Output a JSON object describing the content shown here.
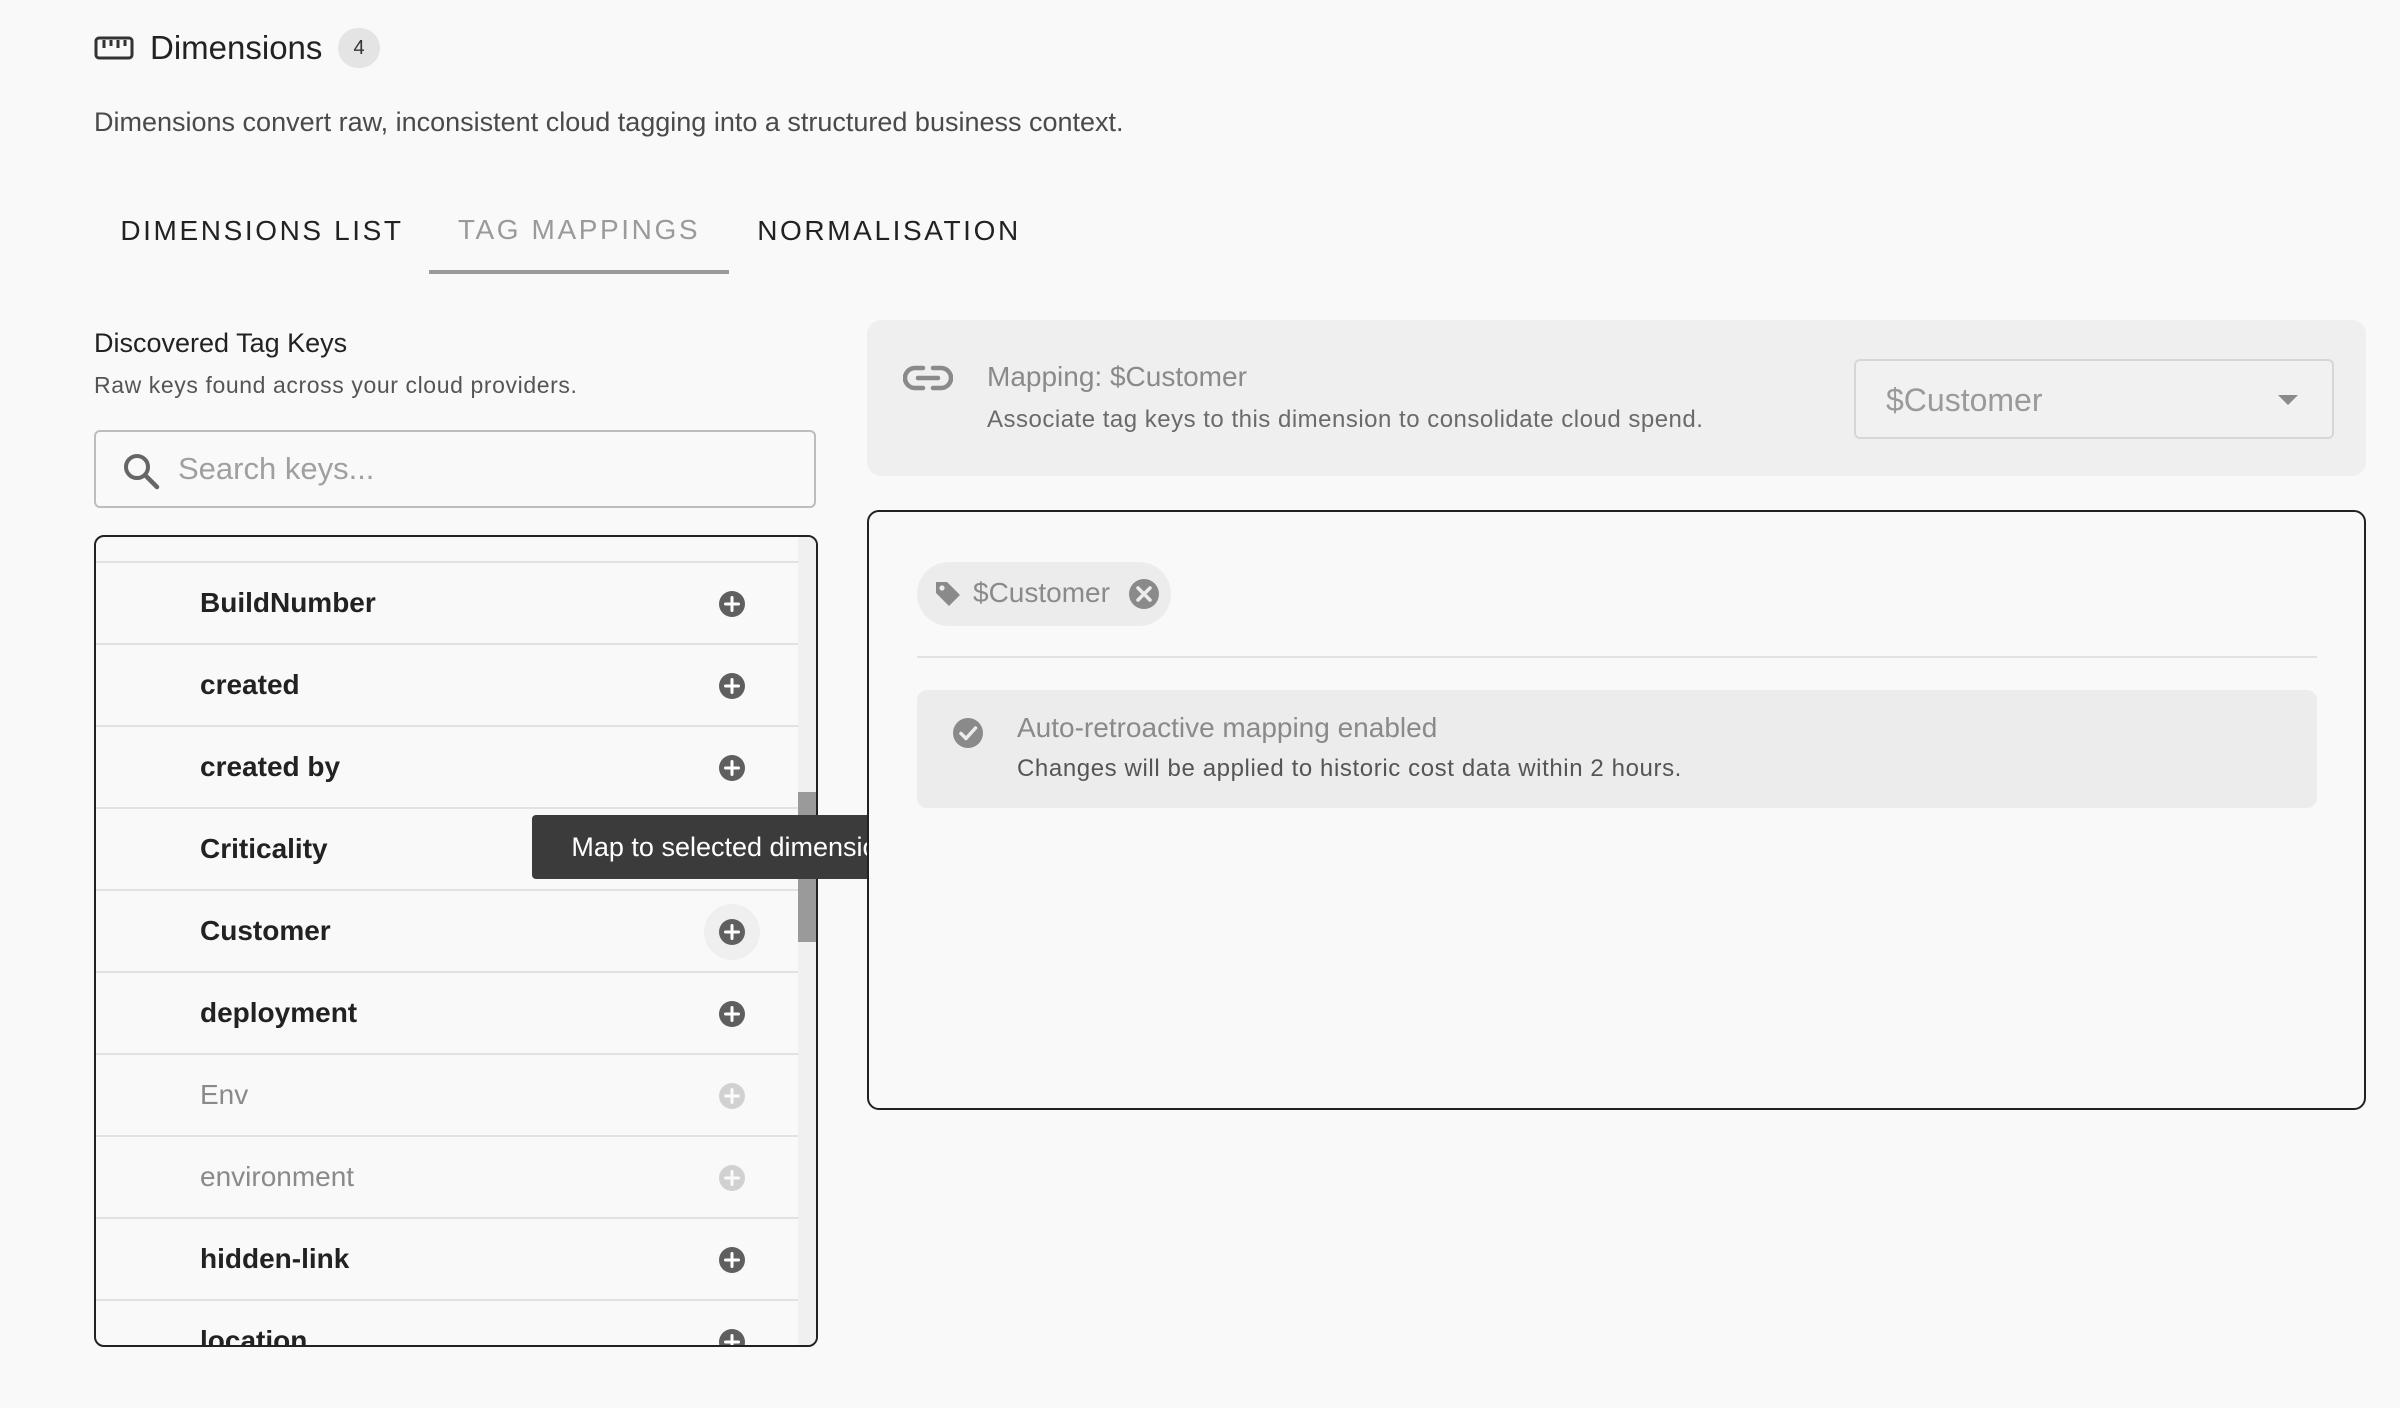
{
  "header": {
    "title": "Dimensions",
    "count": "4",
    "description": "Dimensions convert raw, inconsistent cloud tagging into a structured business context.",
    "icon": "ruler-icon"
  },
  "tabs": [
    {
      "label": "DIMENSIONS LIST",
      "active": false
    },
    {
      "label": "TAG MAPPINGS",
      "active": true
    },
    {
      "label": "NORMALISATION",
      "active": false
    }
  ],
  "discovered": {
    "title": "Discovered Tag Keys",
    "subtitle": "Raw keys found across your cloud providers.",
    "search_placeholder": "Search keys...",
    "search_value": "",
    "items": [
      {
        "label": "BuildNumber",
        "enabled": true
      },
      {
        "label": "created",
        "enabled": true
      },
      {
        "label": "created by",
        "enabled": true
      },
      {
        "label": "Criticality",
        "enabled": true
      },
      {
        "label": "Customer",
        "enabled": true
      },
      {
        "label": "deployment",
        "enabled": true
      },
      {
        "label": "Env",
        "enabled": false
      },
      {
        "label": "environment",
        "enabled": false
      },
      {
        "label": "hidden-link",
        "enabled": true
      },
      {
        "label": "location",
        "enabled": true
      }
    ]
  },
  "tooltip": {
    "text": "Map to selected dimension"
  },
  "mapping": {
    "title": "Mapping: $Customer",
    "description": "Associate tag keys to this dimension to consolidate cloud spend.",
    "selected_dimension": "$Customer",
    "chips": [
      {
        "label": "$Customer"
      }
    ],
    "notice_title": "Auto-retroactive mapping enabled",
    "notice_description": "Changes will be applied to historic cost data within 2 hours."
  },
  "colors": {
    "background": "#f9f9f9",
    "text": "#1f1f1f",
    "muted": "#8a8a8a",
    "tooltip_bg": "#3b3b3b",
    "panel_bg": "#efefef"
  }
}
